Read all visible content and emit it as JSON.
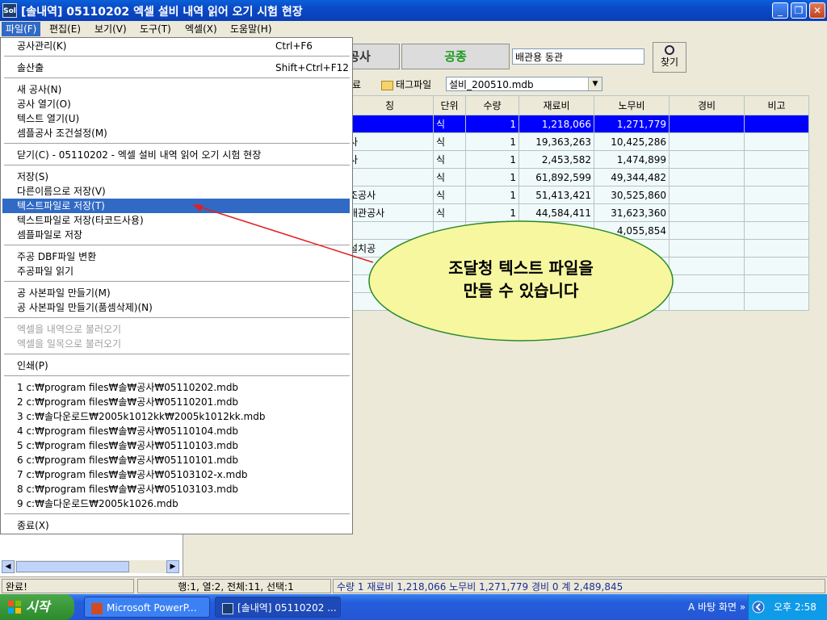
{
  "window": {
    "icon": "Sol",
    "title": "[솔내역] 05110202 엑셀 설비 내역 읽어 오기 시험 현장",
    "controls": {
      "minimize": "_",
      "restore": "❐",
      "close": "✕"
    }
  },
  "menubar": [
    {
      "label": "파일(F)"
    },
    {
      "label": "편집(E)"
    },
    {
      "label": "보기(V)"
    },
    {
      "label": "도구(T)"
    },
    {
      "label": "엑셀(X)"
    },
    {
      "label": "도움말(H)"
    }
  ],
  "toolbar": {
    "tab1": "공사",
    "tab2": "공종",
    "field_value": "배관용 동관",
    "find_label": "찾기",
    "tag_prefix": "료",
    "tag_file": "태그파일",
    "db_file": "설비_200510.mdb"
  },
  "grid": {
    "headers": [
      "칭",
      "단위",
      "수량",
      "재료비",
      "노무비",
      "경비",
      "비고"
    ],
    "rows": [
      [
        "",
        "식",
        "1",
        "1,218,066",
        "1,271,779",
        "",
        ""
      ],
      [
        "사",
        "식",
        "1",
        "19,363,263",
        "10,425,286",
        "",
        ""
      ],
      [
        "사",
        "식",
        "1",
        "2,453,582",
        "1,474,899",
        "",
        ""
      ],
      [
        "",
        "식",
        "1",
        "61,892,599",
        "49,344,482",
        "",
        ""
      ],
      [
        "조공사",
        "식",
        "1",
        "51,413,421",
        "30,525,860",
        "",
        ""
      ],
      [
        "배관공사",
        "식",
        "1",
        "44,584,411",
        "31,623,360",
        "",
        ""
      ],
      [
        "",
        "",
        "",
        "",
        "4,055,854",
        "",
        ""
      ],
      [
        "설치공",
        "",
        "",
        "",
        "",
        "",
        ""
      ],
      [
        "",
        "",
        "",
        "",
        "",
        "",
        ""
      ],
      [
        "",
        "",
        "",
        "",
        "",
        "",
        ""
      ],
      [
        "",
        "",
        "",
        "",
        "",
        "",
        ""
      ]
    ]
  },
  "file_menu": {
    "items": [
      {
        "label": "공사관리(K)",
        "shortcut": "Ctrl+F6"
      },
      {
        "label": "솔산출",
        "shortcut": "Shift+Ctrl+F12"
      },
      {
        "label": "새 공사(N)"
      },
      {
        "label": "공사 열기(O)"
      },
      {
        "label": "텍스트 열기(U)"
      },
      {
        "label": "셈플공사 조건설정(M)"
      },
      {
        "label": "닫기(C) - 05110202 - 엑셀 설비 내역 읽어 오기 시험 현장"
      },
      {
        "label": "저장(S)"
      },
      {
        "label": "다른이름으로 저장(V)"
      },
      {
        "label": "텍스트파일로 저장(T)"
      },
      {
        "label": "텍스트파일로 저장(타코드사용)"
      },
      {
        "label": "셈플파일로 저장"
      },
      {
        "label": "주공 DBF파일 변환"
      },
      {
        "label": "주공파일 읽기"
      },
      {
        "label": "공 사본파일 만들기(M)"
      },
      {
        "label": "공 사본파일 만들기(품셈삭제)(N)"
      },
      {
        "label": "엑셀을 내역으로 불러오기"
      },
      {
        "label": "엑셀을 일목으로 불러오기"
      },
      {
        "label": "인쇄(P)"
      },
      {
        "label": "1 c:₩program files₩솔₩공사₩05110202.mdb"
      },
      {
        "label": "2 c:₩program files₩솔₩공사₩05110201.mdb"
      },
      {
        "label": "3 c:₩솔다운로드₩2005k1012kk₩2005k1012kk.mdb"
      },
      {
        "label": "4 c:₩program files₩솔₩공사₩05110104.mdb"
      },
      {
        "label": "5 c:₩program files₩솔₩공사₩05110103.mdb"
      },
      {
        "label": "6 c:₩program files₩솔₩공사₩05110101.mdb"
      },
      {
        "label": "7 c:₩program files₩솔₩공사₩05103102-x.mdb"
      },
      {
        "label": "8 c:₩program files₩솔₩공사₩05103103.mdb"
      },
      {
        "label": "9 c:₩솔다운로드₩2005k1026.mdb"
      },
      {
        "label": "종료(X)"
      }
    ]
  },
  "callout": {
    "line1": "조달청 텍스트 파일을",
    "line2": "만들 수 있습니다"
  },
  "statusbar": {
    "status": "완료!",
    "position": "행:1, 열:2, 전체:11, 선택:1",
    "summary": "수량 1   재료비 1,218,066   노무비 1,271,779   경비 0   계 2,489,845"
  },
  "taskbar": {
    "start": "시작",
    "tasks": [
      "Microsoft PowerP...",
      "[솔내역] 05110202 ..."
    ],
    "desktop": "바탕 화면",
    "clock": "오후 2:58"
  },
  "colors": {
    "accent": "#316ac5",
    "selection": "#0000ff",
    "callout_fill": "#f7f7a0",
    "arrow": "#e02020"
  }
}
